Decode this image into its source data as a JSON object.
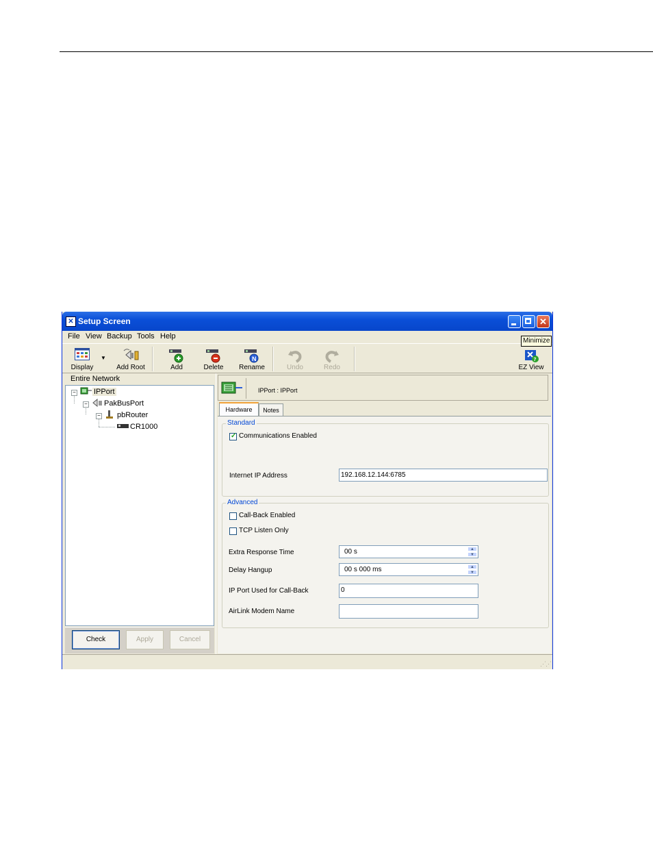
{
  "window": {
    "title": "Setup Screen",
    "tooltip": "Minimize"
  },
  "menu": [
    "File",
    "View",
    "Backup",
    "Tools",
    "Help"
  ],
  "toolbar": {
    "display": "Display",
    "add_root": "Add Root",
    "add": "Add",
    "delete": "Delete",
    "rename": "Rename",
    "undo": "Undo",
    "redo": "Redo",
    "ez_view": "EZ View"
  },
  "network": {
    "header": "Entire Network",
    "nodes": [
      "IPPort",
      "PakBusPort",
      "pbRouter",
      "CR1000"
    ]
  },
  "buttons": {
    "check": "Check",
    "apply": "Apply",
    "cancel": "Cancel"
  },
  "device": {
    "heading": "IPPort : IPPort"
  },
  "tabs": [
    "Hardware",
    "Notes"
  ],
  "standard": {
    "title": "Standard",
    "comms_enabled_label": "Communications Enabled",
    "comms_enabled": true,
    "ip_address_label": "Internet IP Address",
    "ip_address": "192.168.12.144:6785"
  },
  "advanced": {
    "title": "Advanced",
    "callback_label": "Call-Back Enabled",
    "callback": false,
    "tcp_listen_label": "TCP Listen Only",
    "tcp_listen": false,
    "extra_response_label": "Extra Response Time",
    "extra_response": "00 s",
    "delay_hangup_label": "Delay Hangup",
    "delay_hangup": "00 s 000 ms",
    "ip_port_callback_label": "IP Port Used for Call-Back",
    "ip_port_callback": "0",
    "airlink_label": "AirLink Modem Name",
    "airlink": ""
  }
}
